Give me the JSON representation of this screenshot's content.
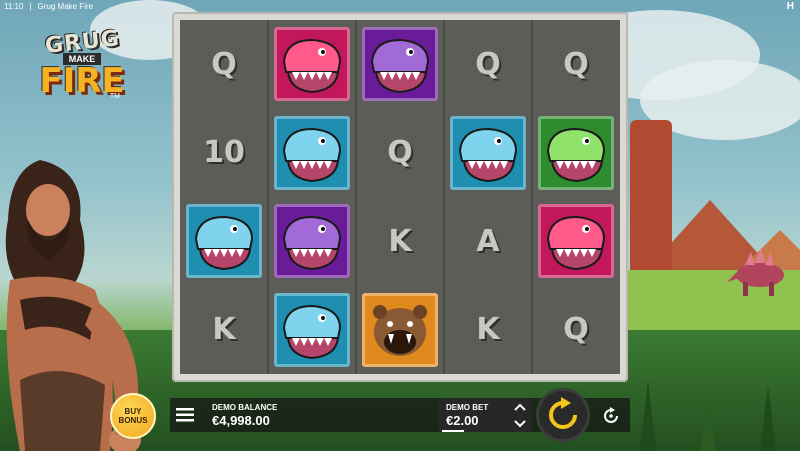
{
  "topbar": {
    "time": "11:10",
    "separator": "|",
    "title": "Grug Make Fire",
    "brand": "H"
  },
  "logo": {
    "line1": "GRUG",
    "line2": "MAKE",
    "line3": "FIRE",
    "tm": "TM"
  },
  "reels": {
    "columns": [
      [
        "Q",
        "10",
        "blue-dino",
        "K"
      ],
      [
        "red-dino",
        "blue-dino",
        "purple-dino",
        "blue-dino"
      ],
      [
        "purple-dino",
        "Q",
        "K",
        "bear"
      ],
      [
        "Q",
        "blue-dino",
        "A",
        "K"
      ],
      [
        "Q",
        "green-dino",
        "red-dino",
        "Q"
      ]
    ]
  },
  "tile_colors": {
    "blue-dino": "#1e8fb0",
    "red-dino": "#c2185b",
    "purple-dino": "#6a1b9a",
    "green-dino": "#2e8b2e",
    "bear": "#e08a1e"
  },
  "controls": {
    "buy_bonus": "BUY BONUS",
    "balance_label": "DEMO BALANCE",
    "balance_value": "€4,998.00",
    "bet_label": "DEMO BET",
    "bet_value": "€2.00"
  },
  "colors": {
    "accent": "#f5c518",
    "panel": "#141414"
  }
}
